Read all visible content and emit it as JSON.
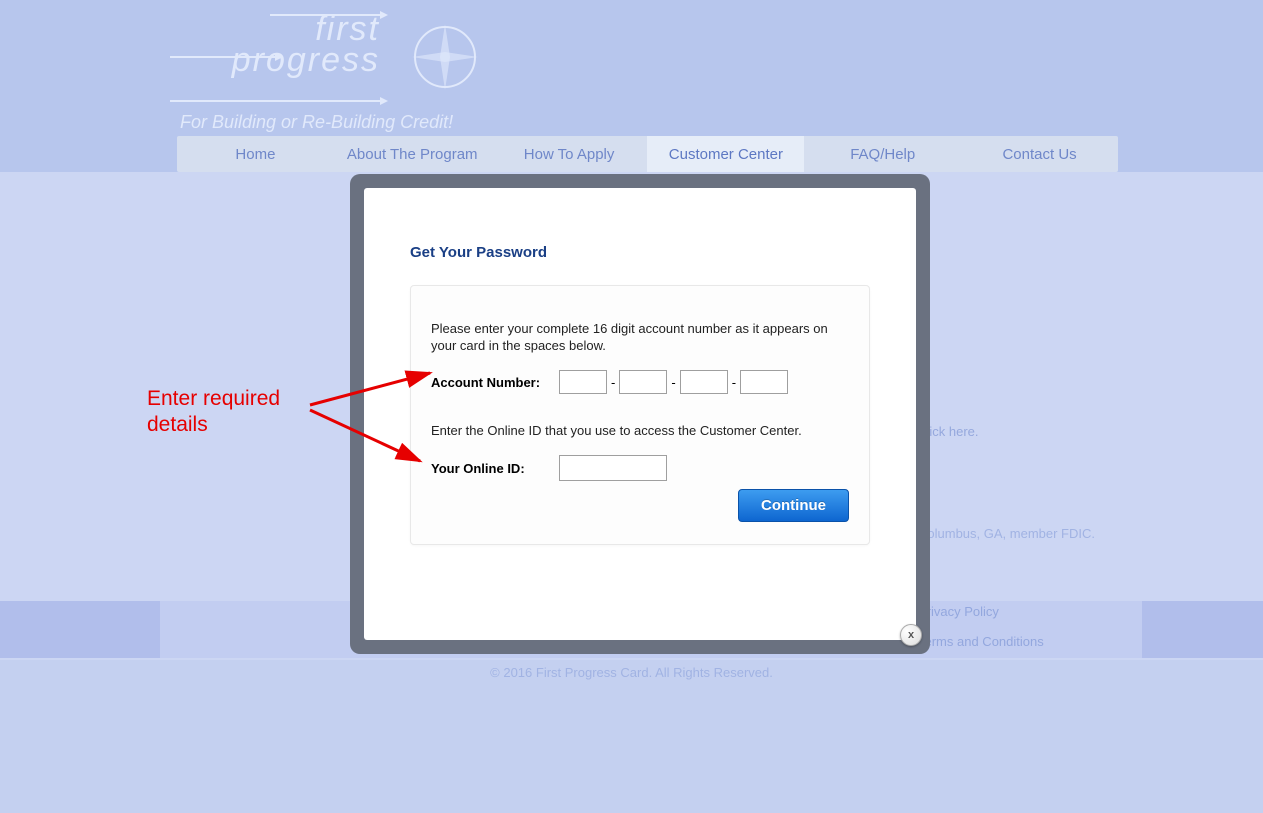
{
  "logo": {
    "line1": "first",
    "line2": "progress",
    "tagline": "For Building or Re-Building Credit!"
  },
  "nav": {
    "items": [
      {
        "label": "Home"
      },
      {
        "label": "About The Program"
      },
      {
        "label": "How To Apply"
      },
      {
        "label": "Customer Center"
      },
      {
        "label": "FAQ/Help"
      },
      {
        "label": "Contact Us"
      }
    ],
    "active_index": 3
  },
  "background_text": {
    "click_here": "click here.",
    "issuer": "Columbus, GA, member FDIC.",
    "privacy": "Privacy Policy",
    "terms": "Terms and Conditions",
    "copyright": "© 2016 First Progress Card. All Rights Reserved."
  },
  "modal": {
    "title": "Get Your Password",
    "instruction_account": "Please enter your complete 16 digit account number as it appears on your card in the spaces below.",
    "label_account": "Account Number:",
    "instruction_online_id": "Enter the Online ID that you use to access the Customer Center.",
    "label_online_id": "Your Online ID:",
    "continue_label": "Continue",
    "close_label": "x"
  },
  "annotation": {
    "text": "Enter required\ndetails"
  }
}
